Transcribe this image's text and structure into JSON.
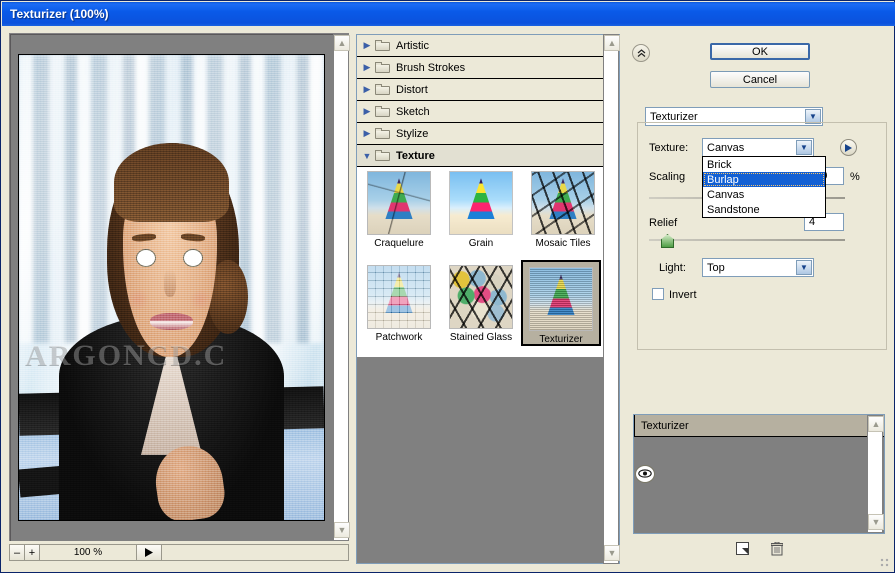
{
  "window": {
    "title": "Texturizer (100%)"
  },
  "preview": {
    "watermark": "ARGONCD.C",
    "zoom_out_label": "–",
    "zoom_in_label": "+",
    "zoom_level": "100 %",
    "play_icon": "play-icon"
  },
  "browser": {
    "categories": [
      {
        "label": "Artistic",
        "expanded": false
      },
      {
        "label": "Brush Strokes",
        "expanded": false
      },
      {
        "label": "Distort",
        "expanded": false
      },
      {
        "label": "Sketch",
        "expanded": false
      },
      {
        "label": "Stylize",
        "expanded": false
      },
      {
        "label": "Texture",
        "expanded": true
      }
    ],
    "filters": [
      {
        "name": "Craquelure",
        "selected": false
      },
      {
        "name": "Grain",
        "selected": false
      },
      {
        "name": "Mosaic Tiles",
        "selected": false
      },
      {
        "name": "Patchwork",
        "selected": false
      },
      {
        "name": "Stained Glass",
        "selected": false
      },
      {
        "name": "Texturizer",
        "selected": true
      }
    ]
  },
  "controls": {
    "collapse_icon": "chevron-double-up-icon",
    "ok_label": "OK",
    "cancel_label": "Cancel",
    "filter_combo_value": "Texturizer",
    "texture_label": "Texture:",
    "texture_value": "Canvas",
    "texture_options": [
      "Brick",
      "Burlap",
      "Canvas",
      "Sandstone"
    ],
    "texture_highlighted": "Burlap",
    "load_texture_icon": "right-arrow-circle-icon",
    "scaling_label": "Scaling",
    "scaling_value": "100",
    "scaling_unit": "%",
    "relief_label": "Relief",
    "relief_value": "4",
    "light_label": "Light:",
    "light_value": "Top",
    "invert_label": "Invert",
    "invert_checked": false
  },
  "layers": {
    "items": [
      {
        "name": "Texturizer",
        "visible": true
      }
    ],
    "new_layer_icon": "new-effect-layer-icon",
    "delete_layer_icon": "trash-icon"
  },
  "colors": {
    "titlebar_blue": "#0b52dd",
    "highlight_blue": "#1260d4",
    "dialog_bg": "#ece9d8",
    "preview_bg": "#808080",
    "selected_thumb": "#b6b0a0"
  }
}
